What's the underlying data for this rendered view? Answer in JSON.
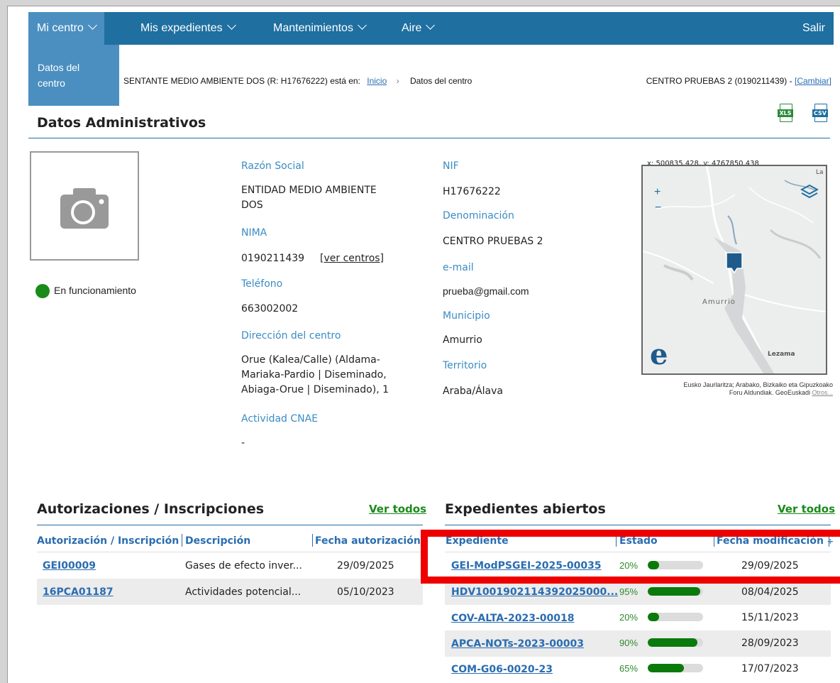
{
  "nav": {
    "items": [
      "Mi centro",
      "Mis expedientes",
      "Mantenimientos",
      "Aire"
    ],
    "logout": "Salir",
    "submenu_item": "Datos del centro"
  },
  "breadcrumb": {
    "user_text": "SENTANTE MEDIO AMBIENTE DOS (R: H17676222) está en:",
    "home": "Inicio",
    "separator": "›",
    "current": "Datos del centro",
    "center": "CENTRO PRUEBAS 2 (0190211439) -",
    "change": "[Cambiar]"
  },
  "export": {
    "xls": "XLS",
    "csv": "CSV"
  },
  "admin": {
    "title": "Datos Administrativos",
    "status": "En funcionamiento",
    "status_color": "#1a8a1a",
    "razon_label": "Razón Social",
    "razon_line1": "ENTIDAD MEDIO AMBIENTE",
    "razon_line2": "DOS",
    "nima_label": "NIMA",
    "nima_value": "0190211439",
    "nima_link": "[ver centros]",
    "telefono_label": "Teléfono",
    "telefono_value": "663002002",
    "direccion_label": "Dirección del centro",
    "direccion_line1": "Orue (Kalea/Calle) (Aldama-",
    "direccion_line2": "Mariaka-Pardio | Diseminado,",
    "direccion_line3": "Abiaga-Orue | Diseminado), 1",
    "cnae_label": "Actividad CNAE",
    "cnae_value": "-",
    "nif_label": "NIF",
    "nif_value": "H17676222",
    "denominacion_label": "Denominación",
    "denominacion_value": "CENTRO PRUEBAS 2",
    "email_label": "e-mail",
    "email_value": "prueba@gmail.com",
    "municipio_label": "Municipio",
    "municipio_value": "Amurrio",
    "territorio_label": "Territorio",
    "territorio_value": "Araba/Álava"
  },
  "map": {
    "coords": "x: 500835.428, y: 4767850.438",
    "zoom_in": "+",
    "zoom_out": "−",
    "corner_text": "La",
    "town": "Amurrio",
    "town2": "Lezama",
    "logo": "e",
    "attribution_line1": "Eusko Jaurlaritza; Arabako, Bizkaiko eta Gipuzkoako",
    "attribution_line2": "Foru Aldundiak. GeoEuskadi",
    "attribution_link": "Otros..."
  },
  "autorizaciones": {
    "title": "Autorizaciones / Inscripciones",
    "view_all": "Ver todos",
    "headers": [
      "Autorización / Inscripción",
      "Descripción",
      "Fecha autorización"
    ],
    "rows": [
      {
        "id": "GEI00009",
        "desc": "Gases de efecto inver...",
        "date": "29/09/2025"
      },
      {
        "id": "16PCA01187",
        "desc": "Actividades potencial...",
        "date": "05/10/2023"
      }
    ]
  },
  "expedientes": {
    "title": "Expedientes abiertos",
    "view_all": "Ver todos",
    "headers": [
      "Expediente",
      "Estado",
      "Fecha modificación"
    ],
    "sort_icon": "÷",
    "rows": [
      {
        "id": "GEI-ModPSGEI-2025-00035",
        "pct": "20%",
        "progress": 0.2,
        "date": "29/09/2025"
      },
      {
        "id": "HDV1001902114392025000...",
        "pct": "95%",
        "progress": 0.95,
        "date": "08/04/2025"
      },
      {
        "id": "COV-ALTA-2023-00018",
        "pct": "20%",
        "progress": 0.2,
        "date": "15/11/2023"
      },
      {
        "id": "APCA-NOTs-2023-00003",
        "pct": "90%",
        "progress": 0.9,
        "date": "28/09/2023"
      },
      {
        "id": "COM-G06-0020-23",
        "pct": "65%",
        "progress": 0.65,
        "date": "17/07/2023"
      }
    ]
  },
  "highlight_color": "#ee0000"
}
